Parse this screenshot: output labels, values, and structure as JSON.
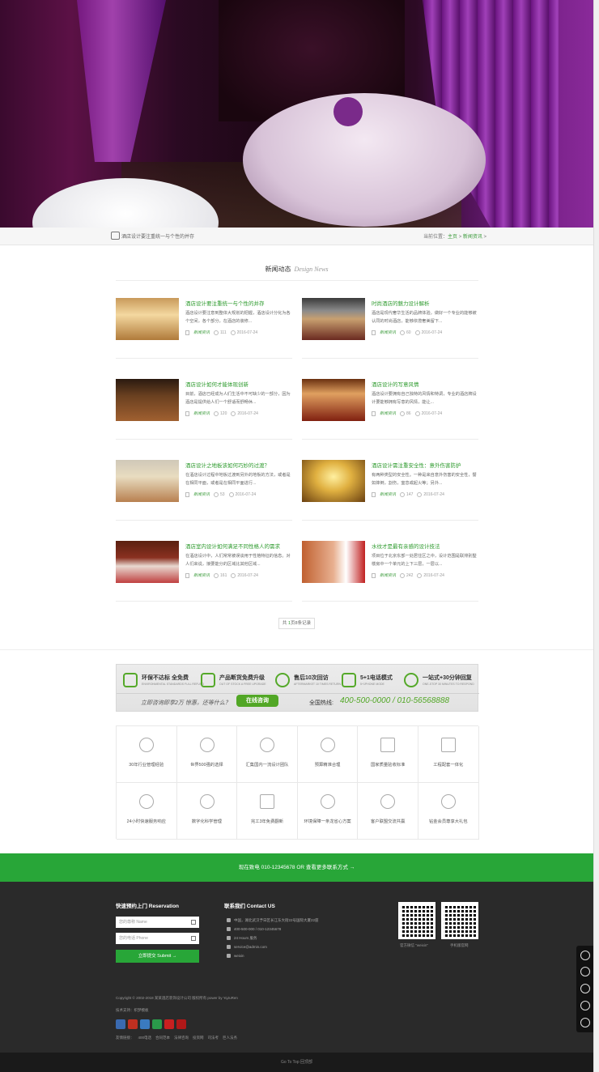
{
  "crumb": {
    "page_title": "酒店设计要注重统一与个性的并存",
    "location_label": "当前位置：",
    "home": "主页",
    "sep": " > ",
    "current": "新闻资讯",
    "arrow": " >"
  },
  "section": {
    "title_cn": "新闻动态",
    "title_en": "Design News"
  },
  "news": [
    {
      "title": "酒店设计要注重统一与个性的并存",
      "desc": "酒店设计要注意到整体大规划的把握，酒店设计分化为各个空间，各个部分，在酒店的装修...",
      "category": "新闻资讯",
      "views": "111",
      "date": "2016-07-24"
    },
    {
      "title": "时尚酒店的魅力设计解析",
      "desc": "酒店是现代奢华生活的品牌体验，做好一个专业的能够被认同的时尚酒店，能够依揽奢美留下...",
      "category": "新闻资讯",
      "views": "60",
      "date": "2016-07-24"
    },
    {
      "title": "酒店设计如何才能体现创新",
      "desc": "目前，酒店已经成为人们生活中不可缺少的一部分，因为酒店是提供给人们一个舒适而舒畅休...",
      "category": "新闻资讯",
      "views": "120",
      "date": "2016-07-24"
    },
    {
      "title": "酒店设计的写意风情",
      "desc": "酒店设计要拥有自己独特的风情和特调，专业的酒店牌设计要能够拥有写意的风情，能让...",
      "category": "新闻资讯",
      "views": "86",
      "date": "2016-07-24"
    },
    {
      "title": "酒店设计之地板该如何巧妙的过渡？",
      "desc": "在酒店设计过程中地板过渡到另外的地板的方法，或者是在相同平面，或者是在相同平面进行...",
      "category": "新闻资讯",
      "views": "53",
      "date": "2016-07-24"
    },
    {
      "title": "酒店设计需注重安全性：意外伤害防护",
      "desc": "有两种类型的安全性。一种是来自意外伤害的安全性，譬如摔倒，割伤，窒息或起火等；另外...",
      "category": "新闻资讯",
      "views": "147",
      "date": "2016-07-24"
    },
    {
      "title": "酒店室内设计如何满足不同性格人的需求",
      "desc": "在酒店设计中，人们常常被误谈用于性格特征的信息。对人们来说，接要能分的区域比其他区域...",
      "category": "新闻资讯",
      "views": "161",
      "date": "2016-07-24"
    },
    {
      "title": "水纹才是最有亲感的设计技法",
      "desc": "项目位于北京东部一处居住区之中，设计范围是联排别墅楼房中一个单元的上下三层，一层以...",
      "category": "新闻资讯",
      "views": "242",
      "date": "2016-07-24"
    }
  ],
  "pager": {
    "prefix": "共 ",
    "count": "1",
    "suffix": "页8条记录"
  },
  "promo": {
    "items": [
      {
        "title": "环保不达标 全免费",
        "sub": "ENVIRONMENTAL STANDARDS FULL REFUND"
      },
      {
        "title": "产品断货免费升级",
        "sub": "OUT OF STOCK A FREE UPGRADE"
      },
      {
        "title": "售后10次回访",
        "sub": "AFTERMARKET 10 TIMES RETURN"
      },
      {
        "title": "5+1电话模式",
        "sub": "5+1PHONE MODE"
      },
      {
        "title": "一站式+30分钟回复",
        "sub": "ONE-STOP 30 MINUTES TO RESPOND"
      }
    ],
    "question": "立即咨询即享2万 惊惠，还等什么？",
    "button": "在线咨询",
    "hotline_label": "全国热线:",
    "hotline": "400-500-0000 / 010-56568888"
  },
  "features": [
    "30年行业管理经验",
    "世界500强的选择",
    "汇集国内一流设计团队",
    "预算精准合理",
    "国家质量验收标准",
    "工程配套一体化",
    "24小时快速服务响应",
    "数字化科学管理",
    "完工3年免费翻新",
    "环境保障一条龙省心方案",
    "客户联盟交流共赢",
    "钻金会员尊享大礼包"
  ],
  "callbar": "现在致电 010-12345678 OR 查看更多联系方式 →",
  "footer": {
    "reserve_title": "快速预约上门 Reservation",
    "name_placeholder": "您的尊称 Name",
    "phone_placeholder": "您的电话 Phone",
    "submit": "立即提交 Submit →",
    "contact_title": "联系我们 Contact US",
    "contact": [
      "中国，湖北武汉予日区长江东大街22号国际大厦22座",
      "400-500-000 / 010-12345678",
      "24 Hours 服务",
      "service@admin.com",
      "weixin"
    ],
    "qr1_caption": "官方微信 \"weixin\"",
    "qr2_caption": "手机版官网",
    "copyright": "Copyright © 2002-2018 某某酒店装饰设计公司 版权所有   power by YqJuRen",
    "tech_label": "技术支持：",
    "tech_value": "织梦模板",
    "links_label": "友情链接：",
    "links": [
      "400电话",
      "合同范本",
      "法律咨询",
      "投资网",
      "司法考",
      "巨人法务"
    ]
  },
  "bottombar": "Go To Top 回顶部",
  "colors": {
    "accent": "#28a638",
    "footer_bg": "#2a2a2a"
  }
}
